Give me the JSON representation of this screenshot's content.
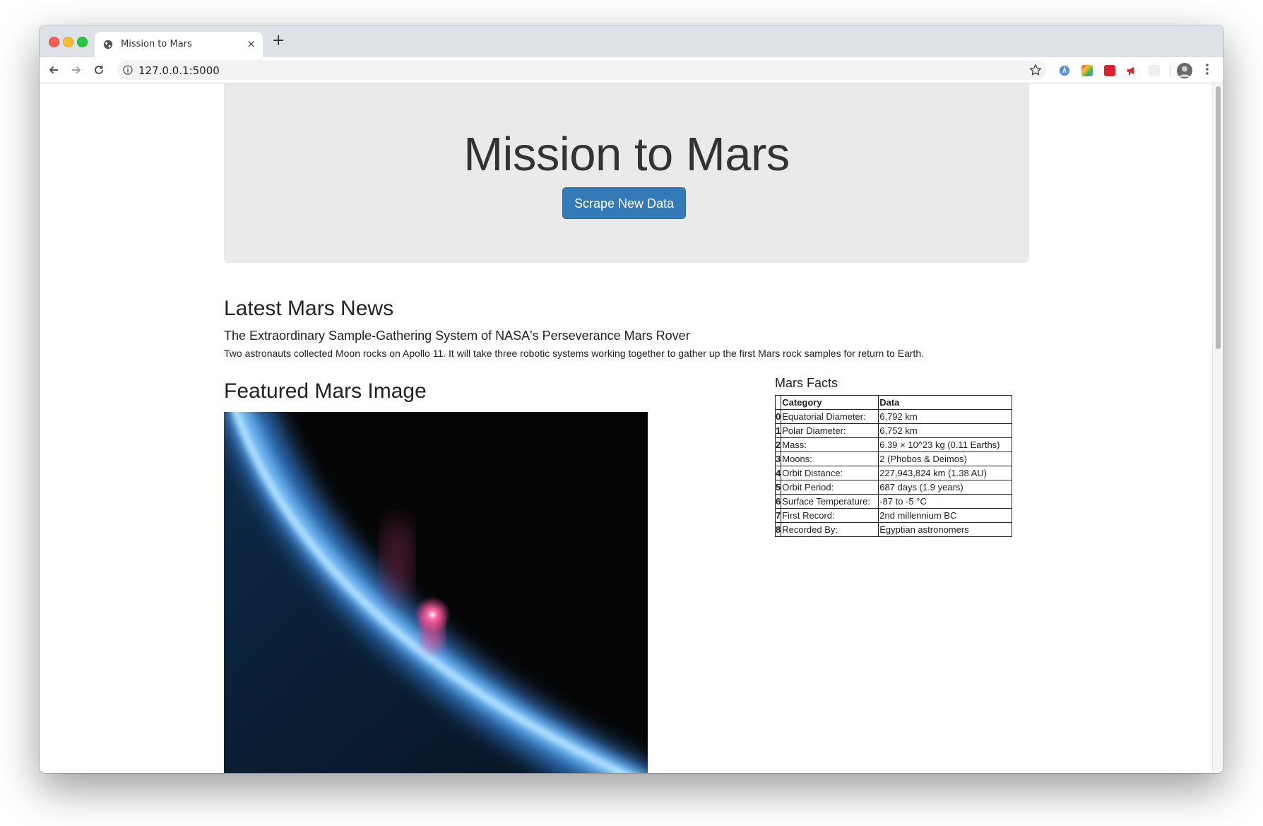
{
  "browser": {
    "tab_title": "Mission to Mars",
    "tab_close": "×",
    "new_tab": "+",
    "url": "127.0.0.1:5000",
    "icons": [
      "back-arrow-icon",
      "forward-arrow-icon",
      "reload-icon",
      "info-icon",
      "star-icon",
      "extension-icons",
      "avatar",
      "menu-icon"
    ]
  },
  "hero": {
    "title": "Mission to Mars",
    "button_label": "Scrape New Data"
  },
  "news": {
    "heading": "Latest Mars News",
    "title": "The Extraordinary Sample-Gathering System of NASA's Perseverance Mars Rover",
    "body": "Two astronauts collected Moon rocks on Apollo 11. It will take three robotic systems working together to gather up the first Mars rock samples for return to Earth."
  },
  "featured": {
    "heading": "Featured Mars Image"
  },
  "facts": {
    "heading": "Mars Facts",
    "columns": [
      "",
      "Category",
      "Data"
    ],
    "rows": [
      {
        "index": "0",
        "category": "Equatorial Diameter:",
        "value": "6,792 km"
      },
      {
        "index": "1",
        "category": "Polar Diameter:",
        "value": "6,752 km"
      },
      {
        "index": "2",
        "category": "Mass:",
        "value": "6.39 × 10^23 kg (0.11 Earths)"
      },
      {
        "index": "3",
        "category": "Moons:",
        "value": "2 (Phobos & Deimos)"
      },
      {
        "index": "4",
        "category": "Orbit Distance:",
        "value": "227,943,824 km (1.38 AU)"
      },
      {
        "index": "5",
        "category": "Orbit Period:",
        "value": "687 days (1.9 years)"
      },
      {
        "index": "6",
        "category": "Surface Temperature:",
        "value": "-87 to -5 °C"
      },
      {
        "index": "7",
        "category": "First Record:",
        "value": "2nd millennium BC"
      },
      {
        "index": "8",
        "category": "Recorded By:",
        "value": "Egyptian astronomers"
      }
    ]
  },
  "colors": {
    "button_bg": "#337ab7",
    "jumbotron_bg": "#eaeaea",
    "text": "#222222"
  }
}
